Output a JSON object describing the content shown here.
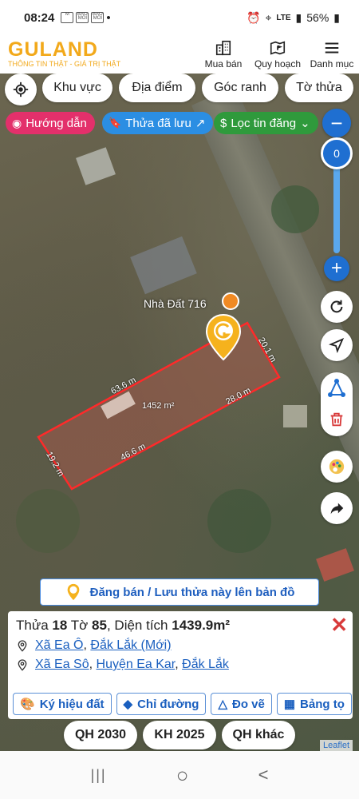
{
  "status": {
    "time": "08:24",
    "mini_icons": [
      "M",
      "BAO MOI",
      "BAO MOI"
    ],
    "dot": "•",
    "network": "LTE",
    "battery": "56%"
  },
  "header": {
    "brand": "GULAND",
    "tagline": "THÔNG TIN THẬT - GIÁ TRỊ THẬT",
    "nav": [
      {
        "label": "Mua bán",
        "icon": "buildings-icon"
      },
      {
        "label": "Quy hoạch",
        "icon": "map-flag-icon"
      },
      {
        "label": "Danh mục",
        "icon": "menu-icon"
      }
    ]
  },
  "filters": [
    "Khu vực",
    "Địa điểm",
    "Góc ranh",
    "Tờ thửa"
  ],
  "tags": {
    "guide": "Hướng dẫn",
    "saved": "Thửa đã lưu",
    "filter": "Lọc tin đăng"
  },
  "slider": {
    "value": "0",
    "fraction": 0.0
  },
  "map": {
    "poi_label": "Nhà Đất 716",
    "plot_area": "1452 m²",
    "edges": [
      "63.6 m",
      "20.1 m",
      "28.0 m",
      "46.6 m",
      "19.2 m"
    ]
  },
  "banner": {
    "text": "Đăng bán / Lưu thửa này lên bản đồ"
  },
  "panel": {
    "title_prefix": "Thửa",
    "parcel": "18",
    "sheet_label": "Tờ",
    "sheet": "85",
    "area_label": ", Diện tích",
    "area": "1439.9m²",
    "loc1": {
      "commune": "Xã Ea Ô",
      "sep": ",",
      "province": "Đắk Lắk (Mới)"
    },
    "loc2": {
      "commune": "Xã Ea Sô",
      "sep1": ",",
      "district": "Huyện Ea Kar",
      "sep2": ",",
      "province": "Đắk Lắk"
    },
    "close": "✕",
    "actions": [
      {
        "label": "Ký hiệu đất",
        "icon": "palette-icon"
      },
      {
        "label": "Chỉ đường",
        "icon": "directions-icon"
      },
      {
        "label": "Đo vẽ",
        "icon": "measure-icon"
      },
      {
        "label": "Bảng tọ",
        "icon": "table-icon"
      }
    ]
  },
  "plans": [
    "QH 2030",
    "KH 2025",
    "QH khác"
  ],
  "attribution": "Leaflet",
  "system_nav": {
    "recent": "|||",
    "home": "○",
    "back": "<"
  }
}
